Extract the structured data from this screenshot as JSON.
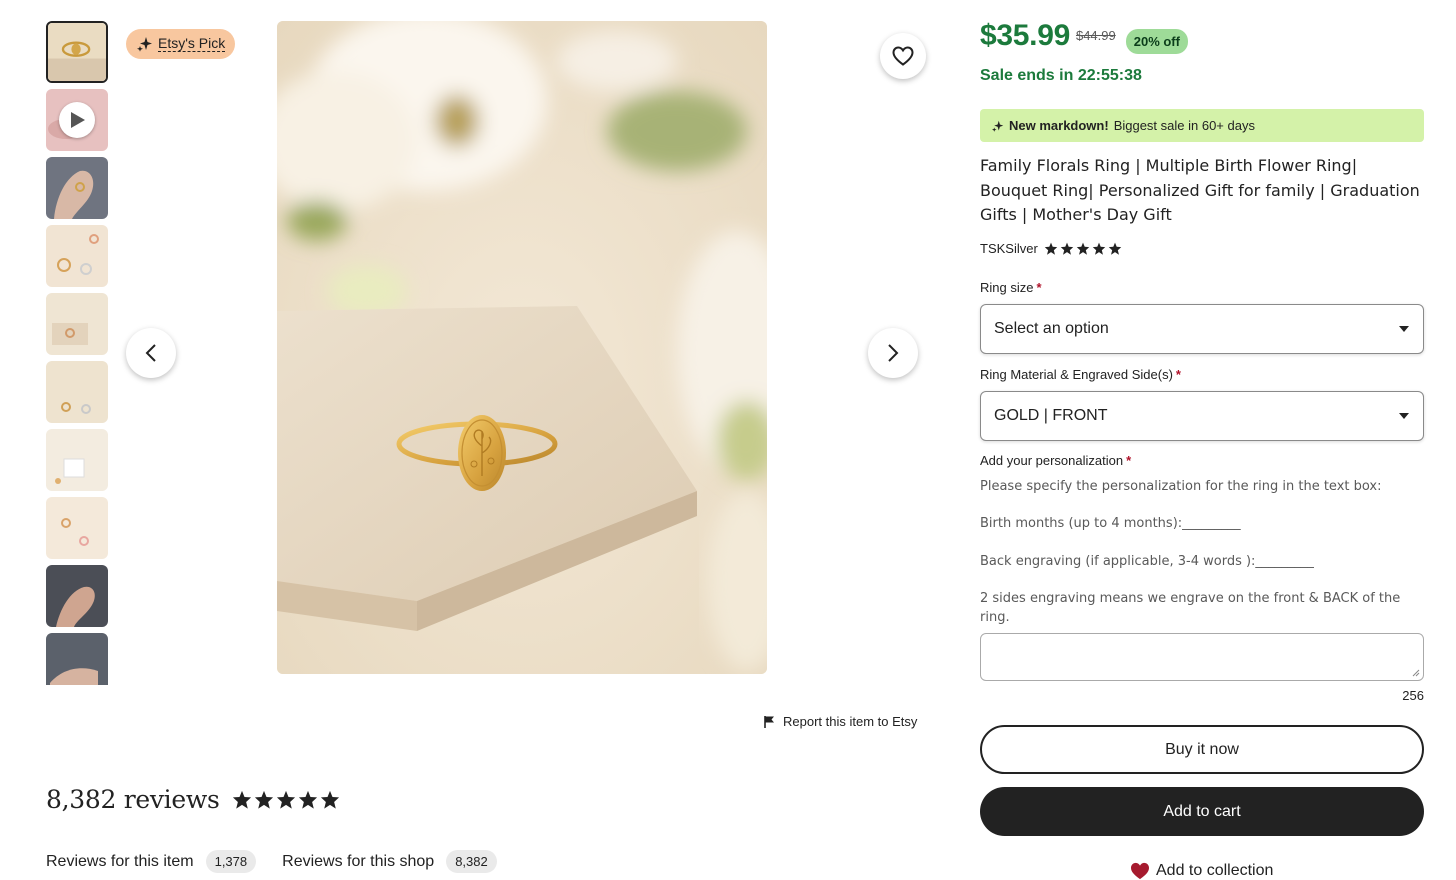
{
  "gallery": {
    "thumbnails": [
      {
        "kind": "image",
        "selected": true
      },
      {
        "kind": "video",
        "selected": false
      },
      {
        "kind": "image",
        "selected": false
      },
      {
        "kind": "image",
        "selected": false
      },
      {
        "kind": "image",
        "selected": false
      },
      {
        "kind": "image",
        "selected": false
      },
      {
        "kind": "image",
        "selected": false
      },
      {
        "kind": "image",
        "selected": false
      },
      {
        "kind": "image",
        "selected": false
      },
      {
        "kind": "image",
        "selected": false
      }
    ],
    "badge": "Etsy's Pick",
    "report_link": "Report this item to Etsy"
  },
  "reviews": {
    "title": "8,382 reviews",
    "rating": 5,
    "tabs": [
      {
        "label": "Reviews for this item",
        "count": "1,378"
      },
      {
        "label": "Reviews for this shop",
        "count": "8,382"
      }
    ]
  },
  "listing": {
    "price": "$35.99",
    "original_price": "$44.99",
    "discount": "20% off",
    "sale_ends": "Sale ends in 22:55:38",
    "markdown_bold": "New markdown!",
    "markdown_text": "Biggest sale in 60+ days",
    "title": "Family Florals Ring | Multiple Birth Flower Ring| Bouquet Ring| Personalized Gift for family | Graduation Gifts | Mother's Day Gift",
    "shop_name": "TSKSilver",
    "shop_rating": 5,
    "ring_size_label": "Ring size",
    "ring_size_value": "Select an option",
    "material_label": "Ring Material & Engraved Side(s)",
    "material_value": "GOLD | FRONT",
    "personalization_label": "Add your personalization",
    "instructions": [
      "Please specify the personalization for the ring in the text box:",
      "Birth months (up to 4 months):_________",
      "Back engraving (if applicable, 3-4 words ):_________",
      "2 sides engraving means we engrave on the front & BACK of the ring."
    ],
    "char_count": "256",
    "buy_now": "Buy it now",
    "add_to_cart": "Add to cart",
    "add_to_collection": "Add to collection"
  },
  "colors": {
    "price_green": "#1c7a3c",
    "discount_bg": "#9edb98",
    "markdown_bg": "#d4f2a9",
    "badge_bg": "#f8c79f",
    "required_red": "#b0122a",
    "cart_button": "#222222",
    "heart_red": "#a61a2e"
  },
  "icons": [
    "play-icon",
    "sparkle-icon",
    "heart-outline-icon",
    "chevron-left-icon",
    "chevron-right-icon",
    "flag-icon",
    "star-icon",
    "caret-down-icon",
    "heart-filled-icon",
    "resize-grip-icon"
  ]
}
